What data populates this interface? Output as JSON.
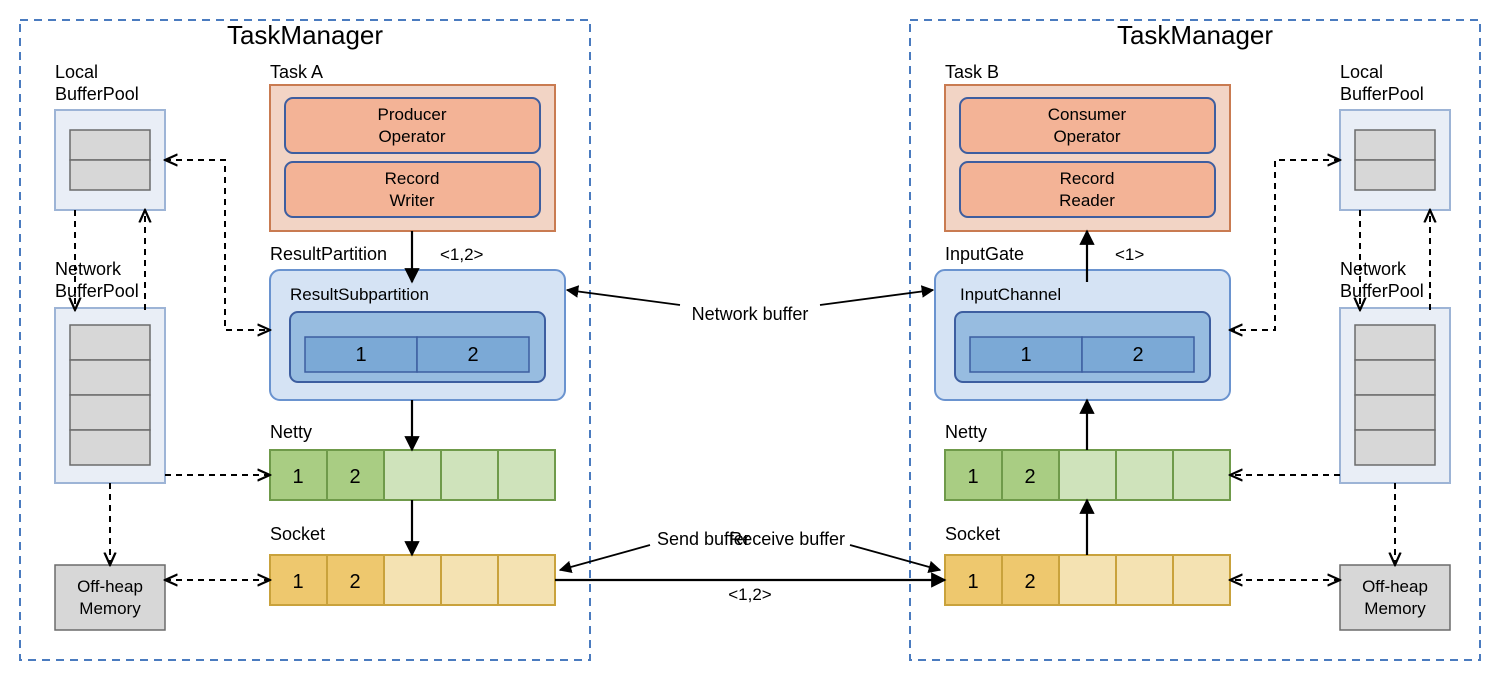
{
  "center": {
    "network_buffer": "Network buffer",
    "send_buffer": "Send buffer",
    "receive_buffer": "Receive buffer",
    "socket_annotation": "<1,2>"
  },
  "left": {
    "title": "TaskManager",
    "local_bufferpool_line1": "Local",
    "local_bufferpool_line2": "BufferPool",
    "network_bufferpool_line1": "Network",
    "network_bufferpool_line2": "BufferPool",
    "offheap_line1": "Off-heap",
    "offheap_line2": "Memory",
    "task_label": "Task A",
    "operator": "Producer\nOperator",
    "record_io": "Record\nWriter",
    "record_annotation": "<1,2>",
    "partition_label": "ResultPartition",
    "sub_label": "ResultSubpartition",
    "sub_cells": [
      "1",
      "2"
    ],
    "netty_label": "Netty",
    "netty_cells": [
      "1",
      "2",
      "",
      "",
      ""
    ],
    "socket_label": "Socket",
    "socket_cells": [
      "1",
      "2",
      "",
      "",
      ""
    ]
  },
  "right": {
    "title": "TaskManager",
    "local_bufferpool_line1": "Local",
    "local_bufferpool_line2": "BufferPool",
    "network_bufferpool_line1": "Network",
    "network_bufferpool_line2": "BufferPool",
    "offheap_line1": "Off-heap",
    "offheap_line2": "Memory",
    "task_label": "Task B",
    "operator": "Consumer\nOperator",
    "record_io": "Record\nReader",
    "record_annotation": "<1>",
    "partition_label": "InputGate",
    "sub_label": "InputChannel",
    "sub_cells": [
      "1",
      "2"
    ],
    "netty_label": "Netty",
    "netty_cells": [
      "1",
      "2",
      "",
      "",
      ""
    ],
    "socket_label": "Socket",
    "socket_cells": [
      "1",
      "2",
      "",
      "",
      ""
    ]
  }
}
